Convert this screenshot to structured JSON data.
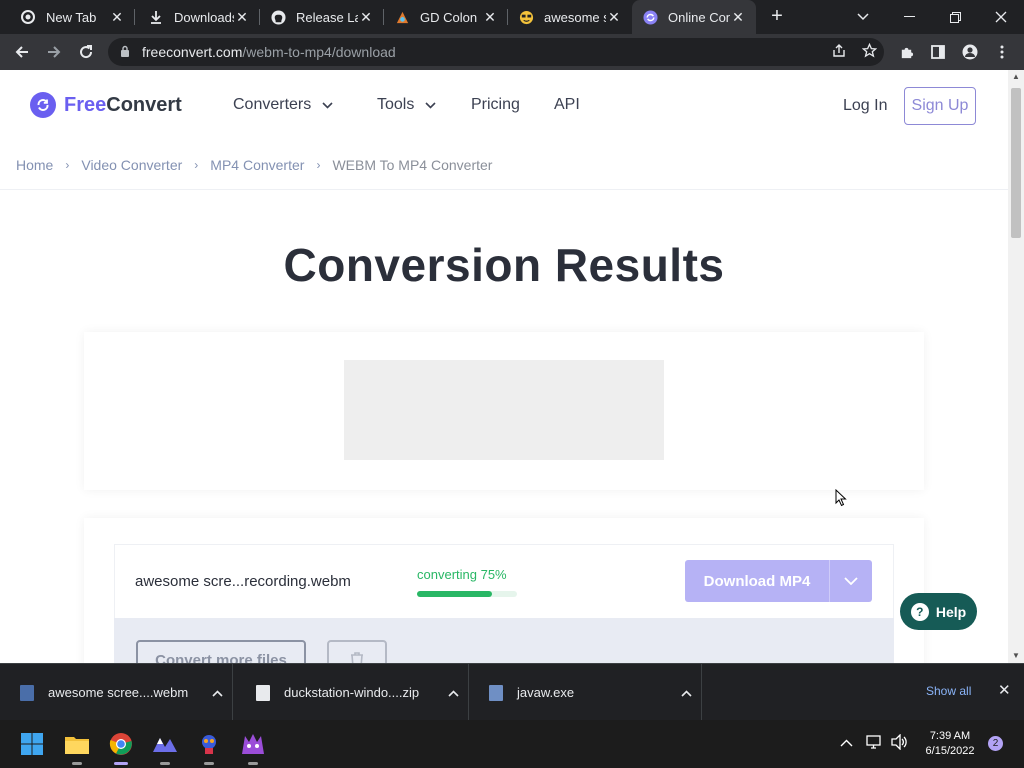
{
  "browser": {
    "tabs": [
      {
        "title": "New Tab",
        "icon": "chrome-icon"
      },
      {
        "title": "Downloads",
        "icon": "download-icon"
      },
      {
        "title": "Release Lat",
        "icon": "github-icon"
      },
      {
        "title": "GD Colon",
        "icon": "gd-colon-icon"
      },
      {
        "title": "awesome s",
        "icon": "emoji-icon"
      },
      {
        "title": "Online Con",
        "icon": "freeconvert-icon",
        "active": true
      }
    ],
    "url_host": "freeconvert.com",
    "url_path": "/webm-to-mp4/download"
  },
  "site": {
    "logo_free": "Free",
    "logo_convert": "Convert",
    "nav": {
      "converters": "Converters",
      "tools": "Tools",
      "pricing": "Pricing",
      "api": "API"
    },
    "login": "Log In",
    "signup": "Sign Up",
    "accent_color": "#6a5ff0"
  },
  "breadcrumb": [
    "Home",
    "Video Converter",
    "MP4 Converter",
    "WEBM To MP4 Converter"
  ],
  "main": {
    "title": "Conversion Results",
    "file": {
      "name": "awesome scre...recording.webm",
      "status": "converting 75%",
      "progress": 0.75,
      "download_label": "Download MP4"
    },
    "convert_more": "Convert more files",
    "help_label": "Help"
  },
  "downloads_shelf": {
    "items": [
      {
        "name": "awesome scree....webm"
      },
      {
        "name": "duckstation-windo....zip"
      },
      {
        "name": "javaw.exe"
      }
    ],
    "show_all": "Show all"
  },
  "taskbar": {
    "time": "7:39 AM",
    "date": "6/15/2022",
    "notifications": "2"
  }
}
